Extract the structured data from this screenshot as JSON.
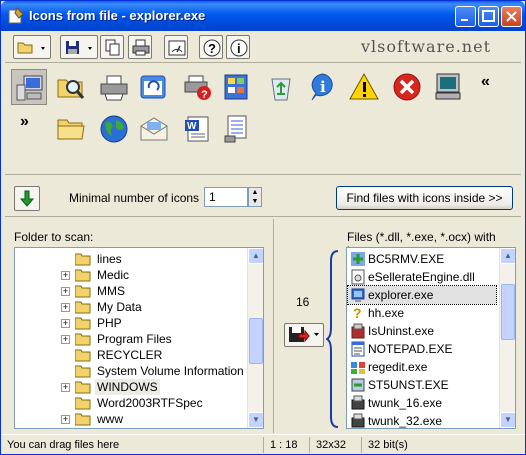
{
  "window": {
    "title": "Icons from file - explorer.exe",
    "controls": [
      "minimize",
      "maximize",
      "close"
    ]
  },
  "toolbar": {
    "buttons": [
      "open-folder",
      "save",
      "copy",
      "print",
      "screenshot",
      "help",
      "about"
    ],
    "brand": "vlsoftware.net"
  },
  "icon_panel": {
    "icons": [
      {
        "name": "my-computer-icon",
        "selected": true
      },
      {
        "name": "search-folder-icon"
      },
      {
        "name": "printer-icon"
      },
      {
        "name": "refresh-window-icon"
      },
      {
        "name": "printer-help-icon"
      },
      {
        "name": "control-panel-icon"
      },
      {
        "name": "recycle-bin-icon"
      },
      {
        "name": "info-icon"
      },
      {
        "name": "warning-icon"
      },
      {
        "name": "error-icon"
      },
      {
        "name": "computer-monitor-icon"
      },
      {
        "name": "folder-icon"
      },
      {
        "name": "globe-icon"
      },
      {
        "name": "mail-icon"
      },
      {
        "name": "word-document-icon"
      },
      {
        "name": "document-list-icon"
      }
    ],
    "prev_label": "«",
    "next_label": "»"
  },
  "controls": {
    "min_icons_label": "Minimal number of icons",
    "min_icons_value": "1",
    "find_button": "Find files with icons inside >>"
  },
  "left_pane": {
    "label": "Folder to scan:",
    "folders": [
      {
        "name": "lines",
        "expandable": false
      },
      {
        "name": "Medic",
        "expandable": true
      },
      {
        "name": "MMS",
        "expandable": true
      },
      {
        "name": "My Data",
        "expandable": true
      },
      {
        "name": "PHP",
        "expandable": true
      },
      {
        "name": "Program Files",
        "expandable": true
      },
      {
        "name": "RECYCLER",
        "expandable": false
      },
      {
        "name": "System Volume Information",
        "expandable": false
      },
      {
        "name": "WINDOWS",
        "expandable": true,
        "selected": true
      },
      {
        "name": "Word2003RTFSpec",
        "expandable": false
      },
      {
        "name": "www",
        "expandable": true
      }
    ]
  },
  "right_pane": {
    "label": "Files (*.dll, *.exe, *.ocx) with icons:",
    "icon_count": "16",
    "files": [
      {
        "name": "BC5RMV.EXE",
        "icon": "bc5rmv-icon"
      },
      {
        "name": "eSellerateEngine.dll",
        "icon": "dll-icon"
      },
      {
        "name": "explorer.exe",
        "icon": "explorer-icon",
        "selected": true
      },
      {
        "name": "hh.exe",
        "icon": "help-question-icon"
      },
      {
        "name": "IsUninst.exe",
        "icon": "uninstall-icon"
      },
      {
        "name": "NOTEPAD.EXE",
        "icon": "notepad-icon"
      },
      {
        "name": "regedit.exe",
        "icon": "regedit-icon"
      },
      {
        "name": "ST5UNST.EXE",
        "icon": "setup-icon"
      },
      {
        "name": "twunk_16.exe",
        "icon": "scanner-icon"
      },
      {
        "name": "twunk_32.exe",
        "icon": "scanner-icon"
      }
    ]
  },
  "status": {
    "message": "You can drag files here",
    "position": "1 : 18",
    "size": "32x32",
    "depth": "32 bit(s)"
  }
}
